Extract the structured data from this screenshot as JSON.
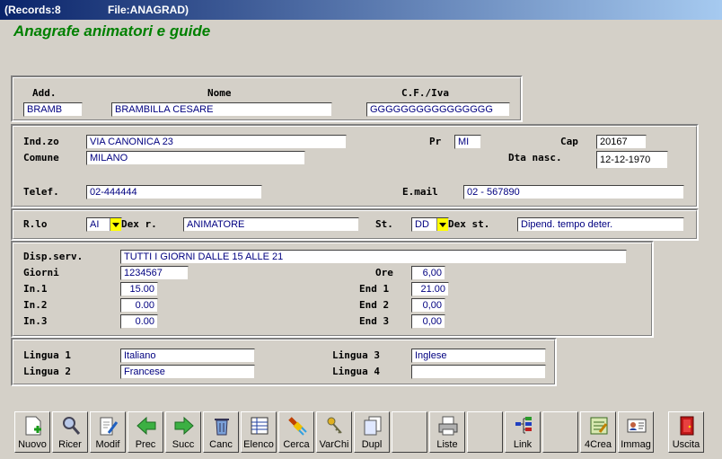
{
  "window": {
    "records": "(Records:8",
    "file": "File:ANAGRAD)"
  },
  "app_title": "Anagrafe animatori e guide",
  "section1": {
    "add_label": "Add.",
    "add_value": "BRAMB",
    "nome_label": "Nome",
    "nome_value": "BRAMBILLA CESARE",
    "cf_label": "C.F./Iva",
    "cf_value": "GGGGGGGGGGGGGGGG"
  },
  "section2": {
    "indzo_label": "Ind.zo",
    "indzo_value": "VIA CANONICA 23",
    "pr_label": "Pr",
    "pr_value": "MI",
    "cap_label": "Cap",
    "cap_value": "20167",
    "comune_label": "Comune",
    "comune_value": "MILANO",
    "dtanasc_label": "Dta nasc.",
    "dtanasc_value": "12-12-1970",
    "telef_label": "Telef.",
    "telef_value": "02-444444",
    "email_label": "E.mail",
    "email_value": "02 - 567890"
  },
  "section3": {
    "ruolo_label": "R.lo",
    "ruolo_value": "AI",
    "dexr_label": "Dex r.",
    "dexr_value": "ANIMATORE",
    "st_label": "St.",
    "st_value": "DD",
    "dexst_label": "Dex st.",
    "dexst_value": "Dipend. tempo deter."
  },
  "section4": {
    "disp_label": "Disp.serv.",
    "disp_value": "TUTTI I GIORNI DALLE 15 ALLE 21",
    "giorni_label": "Giorni",
    "giorni_value": "1234567",
    "ore_label": "Ore",
    "ore_value": "6,00",
    "in1_label": "In.1",
    "in1_value": "15.00",
    "end1_label": "End 1",
    "end1_value": "21.00",
    "in2_label": "In.2",
    "in2_value": "0.00",
    "end2_label": "End 2",
    "end2_value": "0,00",
    "in3_label": "In.3",
    "in3_value": "0.00",
    "end3_label": "End 3",
    "end3_value": "0,00"
  },
  "section5": {
    "l1_label": "Lingua 1",
    "l1_value": "Italiano",
    "l2_label": "Lingua 2",
    "l2_value": "Francese",
    "l3_label": "Lingua 3",
    "l3_value": "Inglese",
    "l4_label": "Lingua 4",
    "l4_value": ""
  },
  "toolbar": {
    "nuovo": "Nuovo",
    "ricer": "Ricer",
    "modif": "Modif",
    "prec": "Prec",
    "succ": "Succ",
    "canc": "Canc",
    "elenco": "Elenco",
    "cerca": "Cerca",
    "varchi": "VarChi",
    "dupl": "Dupl",
    "liste": "Liste",
    "link": "Link",
    "crea": "4Crea",
    "immag": "Immag",
    "uscita": "Uscita"
  }
}
